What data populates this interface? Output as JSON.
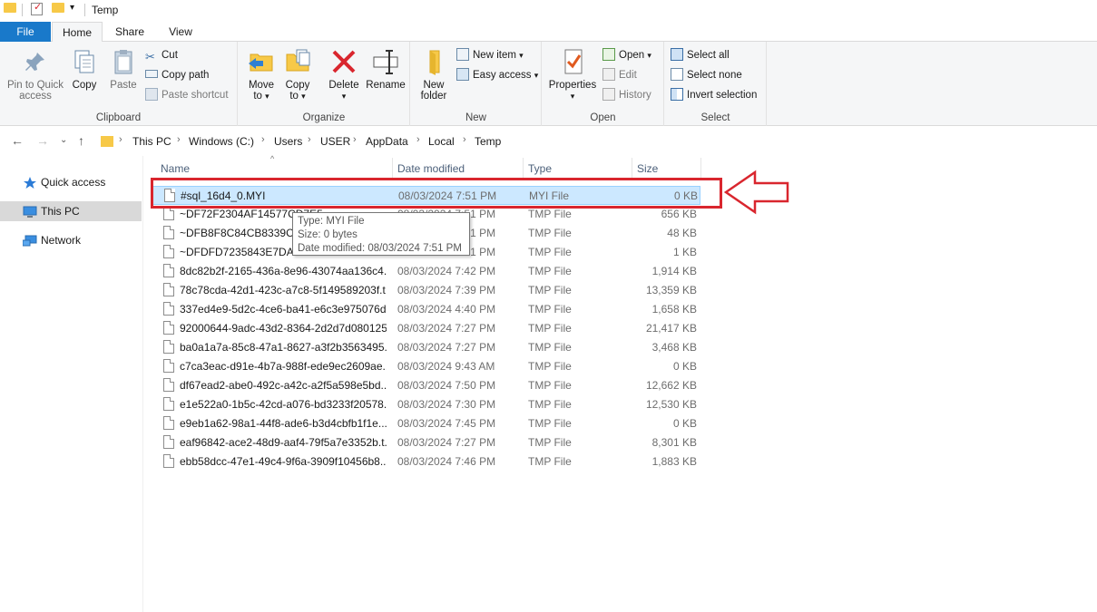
{
  "window": {
    "title": "Temp"
  },
  "tabs": {
    "file": "File",
    "home": "Home",
    "share": "Share",
    "view": "View"
  },
  "ribbon": {
    "clipboard": {
      "label": "Clipboard",
      "pin": "Pin to Quick access",
      "pin_line1": "Pin to Quick",
      "pin_line2": "access",
      "copy": "Copy",
      "paste": "Paste",
      "cut": "Cut",
      "copy_path": "Copy path",
      "paste_shortcut": "Paste shortcut"
    },
    "organize": {
      "label": "Organize",
      "move_to_1": "Move",
      "move_to_2": "to",
      "copy_to_1": "Copy",
      "copy_to_2": "to",
      "delete": "Delete",
      "rename": "Rename"
    },
    "new": {
      "label": "New",
      "new_folder_1": "New",
      "new_folder_2": "folder",
      "new_item": "New item",
      "easy_access": "Easy access"
    },
    "open": {
      "label": "Open",
      "properties": "Properties",
      "open": "Open",
      "edit": "Edit",
      "history": "History"
    },
    "select": {
      "label": "Select",
      "select_all": "Select all",
      "select_none": "Select none",
      "invert_selection": "Invert selection"
    }
  },
  "breadcrumb": [
    "This PC",
    "Windows (C:)",
    "Users",
    "USER",
    "AppData",
    "Local",
    "Temp"
  ],
  "nav": {
    "quick_access": "Quick access",
    "this_pc": "This PC",
    "network": "Network"
  },
  "columns": {
    "name": "Name",
    "date": "Date modified",
    "type": "Type",
    "size": "Size"
  },
  "files": [
    {
      "name": "#sql_16d4_0.MYI",
      "date": "08/03/2024 7:51 PM",
      "type": "MYI File",
      "size": "0 KB"
    },
    {
      "name": "~DF72F2304AF14577CD7E5...",
      "date": "08/03/2024 7:51 PM",
      "type": "TMP File",
      "size": "656 KB"
    },
    {
      "name": "~DFB8F8C84CB8339CF7...",
      "date": "08/03/2024 7:51 PM",
      "type": "TMP File",
      "size": "48 KB"
    },
    {
      "name": "~DFDFD7235843E7DA07...",
      "date": "08/03/2024 7:51 PM",
      "type": "TMP File",
      "size": "1 KB"
    },
    {
      "name": "8dc82b2f-2165-436a-8e96-43074aa136c4....",
      "date": "08/03/2024 7:42 PM",
      "type": "TMP File",
      "size": "1,914 KB"
    },
    {
      "name": "78c78cda-42d1-423c-a7c8-5f149589203f.t...",
      "date": "08/03/2024 7:39 PM",
      "type": "TMP File",
      "size": "13,359 KB"
    },
    {
      "name": "337ed4e9-5d2c-4ce6-ba41-e6c3e975076d...",
      "date": "08/03/2024 4:40 PM",
      "type": "TMP File",
      "size": "1,658 KB"
    },
    {
      "name": "92000644-9adc-43d2-8364-2d2d7d080125...",
      "date": "08/03/2024 7:27 PM",
      "type": "TMP File",
      "size": "21,417 KB"
    },
    {
      "name": "ba0a1a7a-85c8-47a1-8627-a3f2b3563495....",
      "date": "08/03/2024 7:27 PM",
      "type": "TMP File",
      "size": "3,468 KB"
    },
    {
      "name": "c7ca3eac-d91e-4b7a-988f-ede9ec2609ae....",
      "date": "08/03/2024 9:43 AM",
      "type": "TMP File",
      "size": "0 KB"
    },
    {
      "name": "df67ead2-abe0-492c-a42c-a2f5a598e5bd....",
      "date": "08/03/2024 7:50 PM",
      "type": "TMP File",
      "size": "12,662 KB"
    },
    {
      "name": "e1e522a0-1b5c-42cd-a076-bd3233f20578....",
      "date": "08/03/2024 7:30 PM",
      "type": "TMP File",
      "size": "12,530 KB"
    },
    {
      "name": "e9eb1a62-98a1-44f8-ade6-b3d4cbfb1f1e....",
      "date": "08/03/2024 7:45 PM",
      "type": "TMP File",
      "size": "0 KB"
    },
    {
      "name": "eaf96842-ace2-48d9-aaf4-79f5a7e3352b.t...",
      "date": "08/03/2024 7:27 PM",
      "type": "TMP File",
      "size": "8,301 KB"
    },
    {
      "name": "ebb58dcc-47e1-49c4-9f6a-3909f10456b8....",
      "date": "08/03/2024 7:46 PM",
      "type": "TMP File",
      "size": "1,883 KB"
    }
  ],
  "tooltip": {
    "type": "Type: MYI File",
    "size": "Size: 0 bytes",
    "date": "Date modified: 08/03/2024 7:51 PM"
  },
  "colors": {
    "accent": "#1979ca",
    "highlight": "#d9262e",
    "selection": "#cce8ff"
  }
}
